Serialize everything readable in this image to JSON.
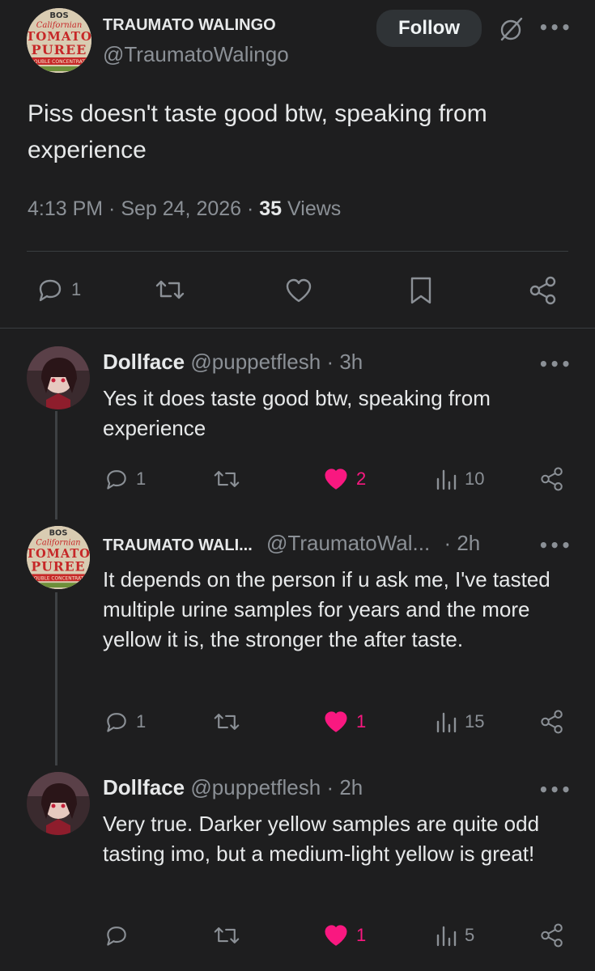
{
  "main_tweet": {
    "display_name": "TRAUMATO WALINGO",
    "handle": "@TraumatoWalingo",
    "follow_label": "Follow",
    "text": "Piss doesn't taste good btw, speaking from experience",
    "time": "4:13 PM · Sep 24, 2026 · ",
    "views_count": "35",
    "views_label": " Views",
    "reply_count": "1",
    "avatar_text": [
      "BOS",
      "Californian",
      "TOMATO",
      "PUREE",
      "DOUBLE CONCENTRATE"
    ]
  },
  "replies": [
    {
      "display_name": "Dollface",
      "handle": "@puppetflesh · 3h",
      "text": "Yes it does taste good btw, speaking from experience",
      "reply_count": "1",
      "like_count": "2",
      "view_count": "10"
    },
    {
      "display_name": "TRAUMATO WALI...",
      "handle": "@TraumatoWal...",
      "time": "· 2h",
      "text": "It depends on the person if u ask me, I've tasted multiple urine samples for years and the more yellow it is, the stronger the after taste.",
      "reply_count": "1",
      "like_count": "1",
      "view_count": "15"
    },
    {
      "display_name": "Dollface",
      "handle": "@puppetflesh · 2h",
      "text": "Very true. Darker yellow samples are quite odd tasting imo, but a medium-light yellow is great!",
      "like_count": "1",
      "view_count": "5"
    }
  ],
  "colors": {
    "background": "#1e1e1f",
    "like_pink": "#f91880",
    "muted": "#8b9096"
  },
  "icons": [
    "reply-icon",
    "retweet-icon",
    "like-icon",
    "bookmark-icon",
    "share-icon",
    "views-icon",
    "more-icon",
    "grok-icon"
  ]
}
